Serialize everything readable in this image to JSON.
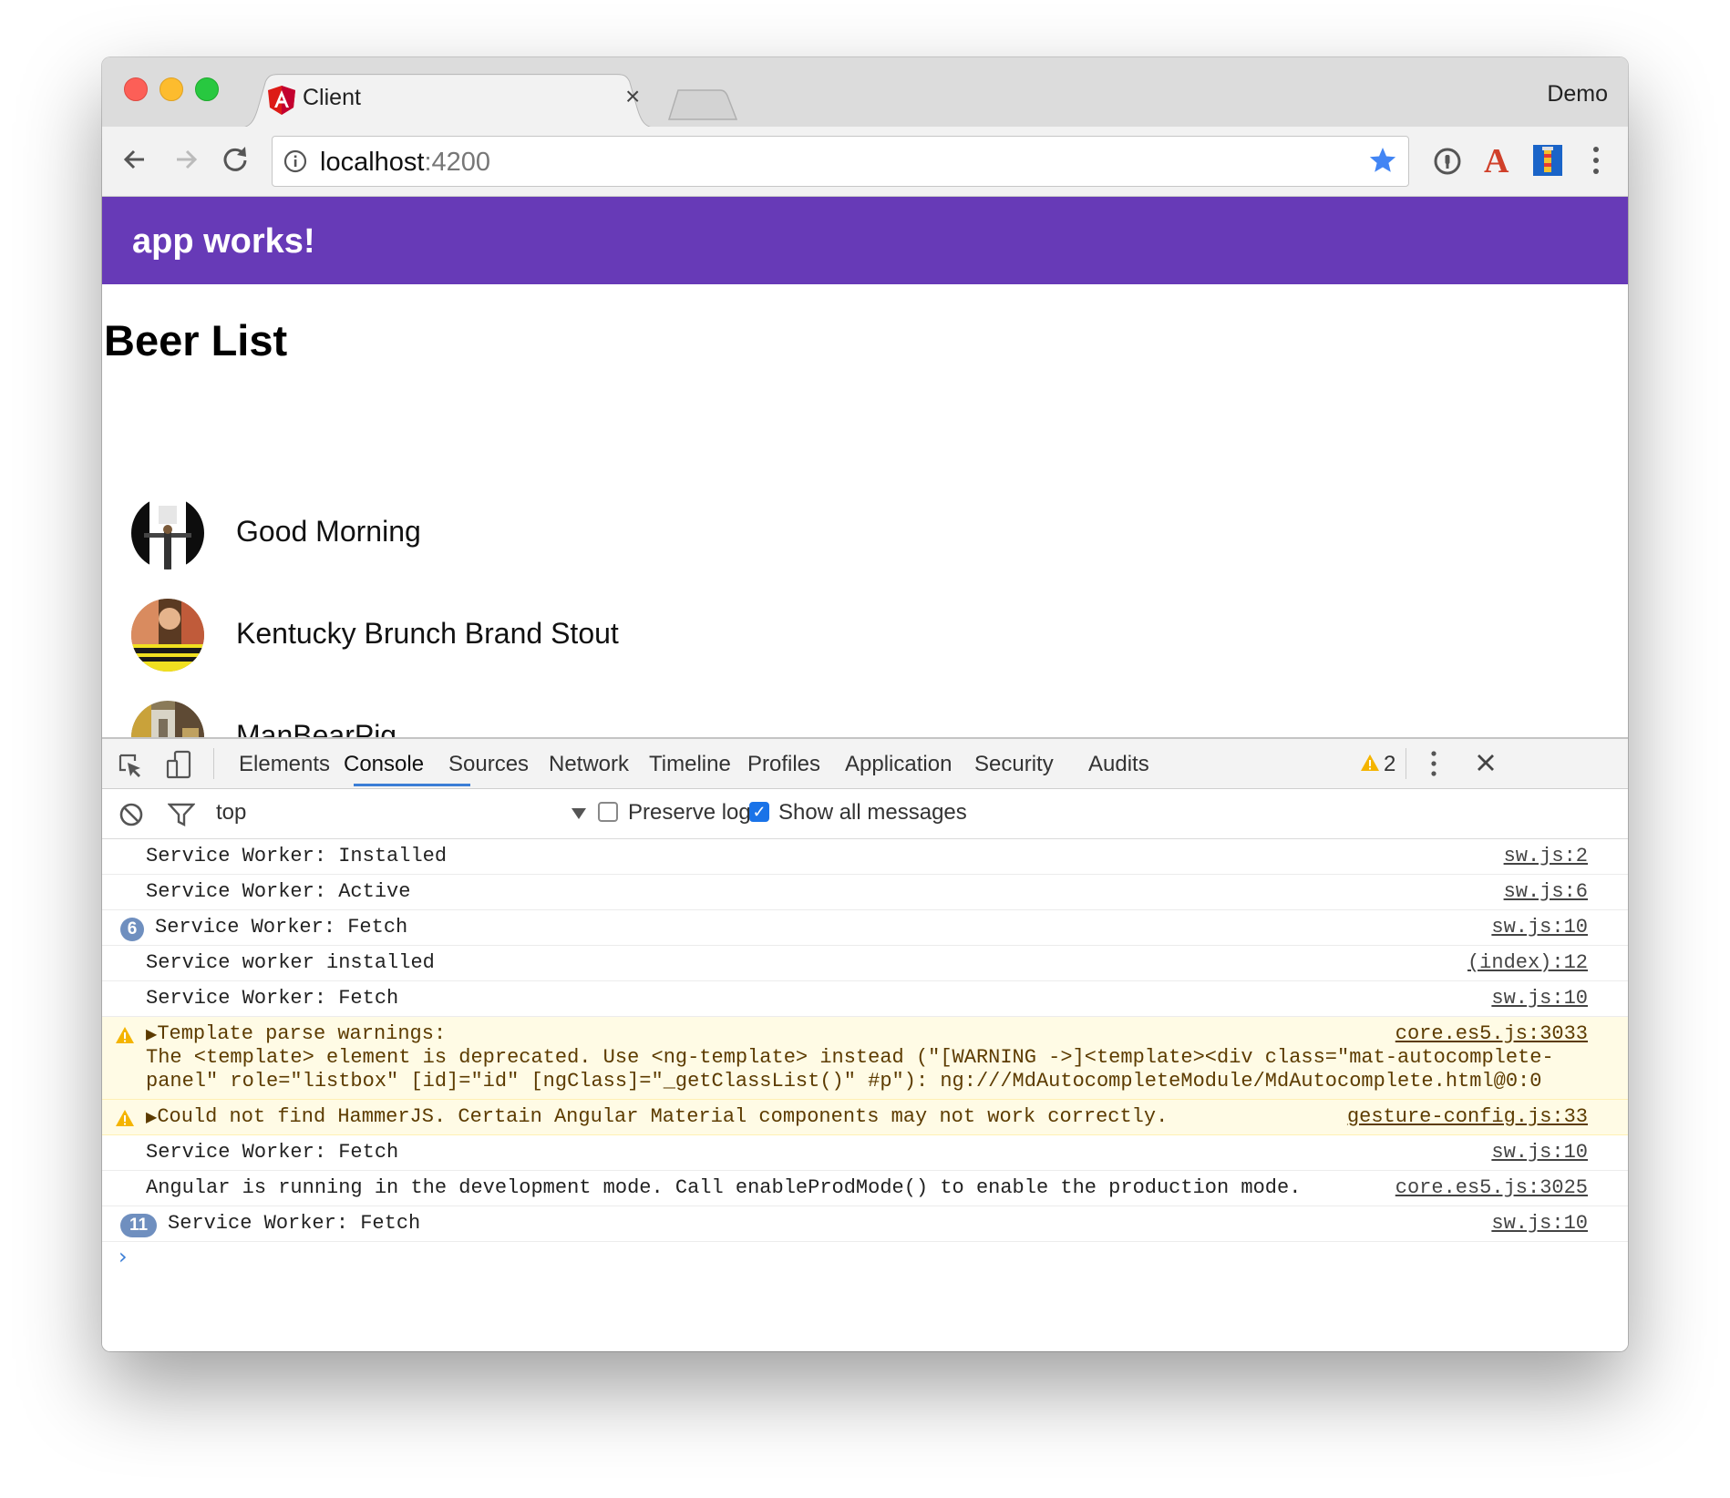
{
  "browser": {
    "tab_title": "Client",
    "tab_close": "×",
    "profile_name": "Demo",
    "url_host": "localhost",
    "url_port": ":4200"
  },
  "app": {
    "toolbar_title": "app works!",
    "heading": "Beer List",
    "beers": [
      {
        "name": "Good Morning"
      },
      {
        "name": "Kentucky Brunch Brand Stout"
      },
      {
        "name": "ManBearPig"
      }
    ]
  },
  "devtools": {
    "tabs": [
      "Elements",
      "Console",
      "Sources",
      "Network",
      "Timeline",
      "Profiles",
      "Application",
      "Security",
      "Audits"
    ],
    "active_tab": "Console",
    "warning_count": "2",
    "context": "top",
    "preserve_log_label": "Preserve log",
    "preserve_log_checked": false,
    "show_all_label": "Show all messages",
    "show_all_checked": true,
    "console_rows": [
      {
        "text": "Service Worker: Installed",
        "source": "sw.js:2"
      },
      {
        "text": "Service Worker: Active",
        "source": "sw.js:6"
      },
      {
        "badge": "6",
        "text": "Service Worker: Fetch",
        "source": "sw.js:10"
      },
      {
        "text": "Service worker installed",
        "source": "(index):12"
      },
      {
        "text": "Service Worker: Fetch",
        "source": "sw.js:10"
      },
      {
        "level": "warning",
        "text": "Template parse warnings:",
        "detail_1": "The <template> element is deprecated. Use <ng-template> instead (\"[WARNING ->]<template><div class=\"mat-autocomplete-",
        "detail_2": "panel\" role=\"listbox\" [id]=\"id\" [ngClass]=\"_getClassList()\" #p\"): ng:///MdAutocompleteModule/MdAutocomplete.html@0:0",
        "source": "core.es5.js:3033"
      },
      {
        "level": "warning",
        "text": "Could not find HammerJS. Certain Angular Material components may not work correctly.",
        "source": "gesture-config.js:33"
      },
      {
        "text": "Service Worker: Fetch",
        "source": "sw.js:10"
      },
      {
        "text": "Angular is running in the development mode. Call enableProdMode() to enable the production mode.",
        "source": "core.es5.js:3025"
      },
      {
        "badge": "11",
        "text": "Service Worker: Fetch",
        "source": "sw.js:10"
      }
    ]
  },
  "colors": {
    "app_toolbar": "#673ab7",
    "warning_bg": "#fffbe5",
    "accent": "#3b7ed6"
  }
}
